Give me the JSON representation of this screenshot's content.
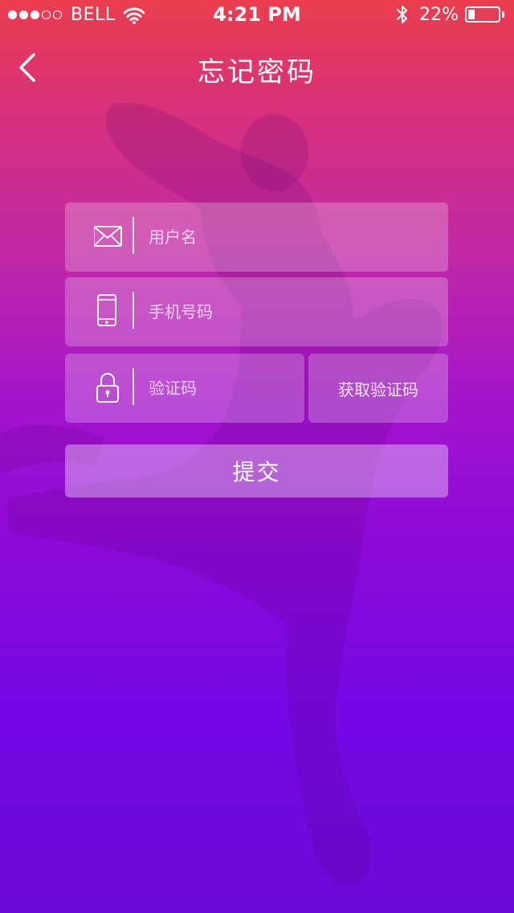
{
  "status_bar": {
    "carrier": "BELL",
    "signal_bars_filled": 3,
    "signal_bars_total": 5,
    "time": "4:21 PM",
    "battery_text": "22%",
    "battery_level": 0.22,
    "icons": [
      "wifi-icon",
      "bluetooth-icon",
      "battery-icon"
    ]
  },
  "nav": {
    "title": "忘记密码",
    "back_icon": "chevron-left-icon"
  },
  "form": {
    "username": {
      "placeholder": "用户名",
      "value": "",
      "icon": "mail-icon"
    },
    "phone": {
      "placeholder": "手机号码",
      "value": "",
      "icon": "phone-icon"
    },
    "code": {
      "placeholder": "验证码",
      "value": "",
      "icon": "lock-icon"
    },
    "get_code_label": "获取验证码",
    "submit_label": "提交"
  },
  "colors": {
    "gradient_top": "#ea3e4e",
    "gradient_mid": "#a112cf",
    "gradient_bottom": "#6a0ad8"
  }
}
